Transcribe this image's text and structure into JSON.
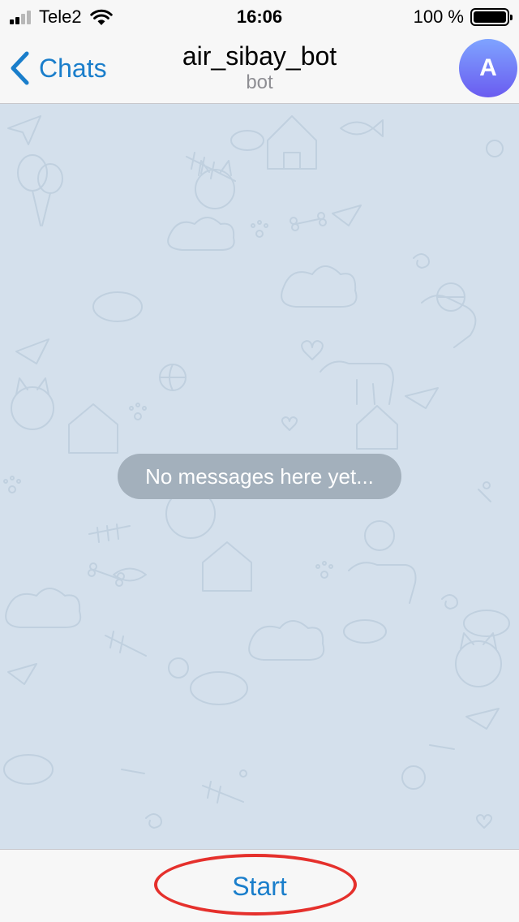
{
  "status_bar": {
    "carrier": "Tele2",
    "time": "16:06",
    "battery": "100 %",
    "signal_bars_filled": 2,
    "signal_bars_total": 4,
    "battery_level": 1.0,
    "icons": [
      "signal-icon",
      "wifi-icon",
      "battery-icon"
    ]
  },
  "nav": {
    "back_label": "Chats",
    "title": "air_sibay_bot",
    "subtitle": "bot",
    "avatar_initial": "A",
    "back_icon": "chevron-left-icon"
  },
  "chat": {
    "empty_text": "No messages here yet..."
  },
  "bottom": {
    "start_label": "Start"
  },
  "colors": {
    "accent": "#1a7ecb",
    "chat_background": "#d4e0ec",
    "empty_pill": "#a3b0bc",
    "annotation": "#e5302c",
    "avatar_gradient_top": "#7fa4ff",
    "avatar_gradient_bottom": "#6a5cf0"
  }
}
